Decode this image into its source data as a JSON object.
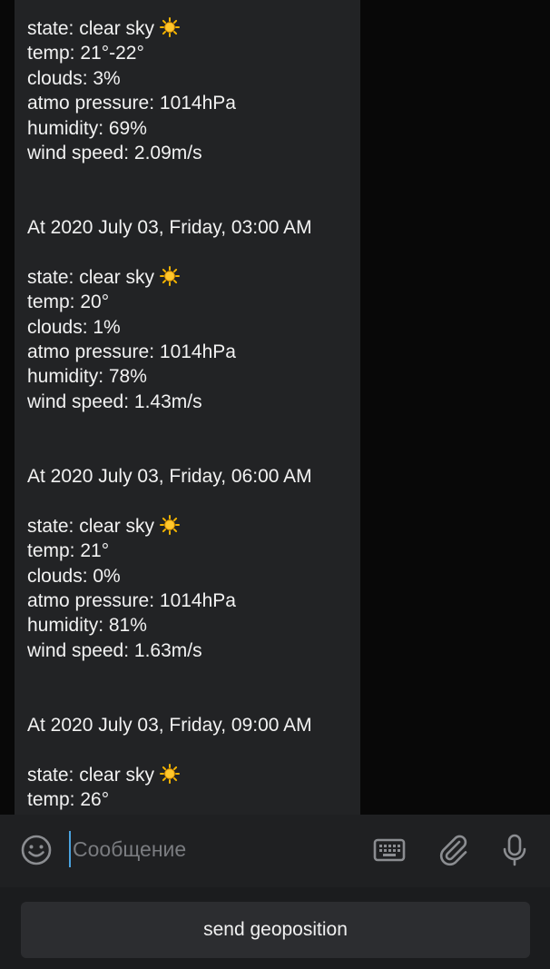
{
  "forecast": {
    "blocks": [
      {
        "heading": "",
        "state": "state: clear sky",
        "temp": "temp: 21°-22°",
        "clouds": "clouds: 3%",
        "pressure": "atmo pressure: 1014hPa",
        "humidity": "humidity: 69%",
        "wind": "wind speed: 2.09m/s"
      },
      {
        "heading": "At 2020 July 03, Friday, 03:00 AM",
        "state": "state: clear sky",
        "temp": "temp: 20°",
        "clouds": "clouds: 1%",
        "pressure": "atmo pressure: 1014hPa",
        "humidity": "humidity: 78%",
        "wind": "wind speed: 1.43m/s"
      },
      {
        "heading": "At 2020 July 03, Friday, 06:00 AM",
        "state": "state: clear sky",
        "temp": "temp: 21°",
        "clouds": "clouds: 0%",
        "pressure": "atmo pressure: 1014hPa",
        "humidity": "humidity: 81%",
        "wind": "wind speed: 1.63m/s"
      },
      {
        "heading": "At 2020 July 03, Friday, 09:00 AM",
        "state": "state: clear sky",
        "temp": "temp: 26°"
      }
    ],
    "weather_icon": "sun-icon"
  },
  "input_bar": {
    "placeholder": "Сообщение",
    "value": "",
    "icons": [
      "emoji-icon",
      "keyboard-icon",
      "attach-icon",
      "microphone-icon"
    ]
  },
  "keyboard": {
    "send_geoposition_label": "send geoposition"
  },
  "colors": {
    "bubble_bg": "#222325",
    "chat_bg": "#080808",
    "caret": "#4aa3df",
    "input_bar_bg": "#1f2022"
  }
}
